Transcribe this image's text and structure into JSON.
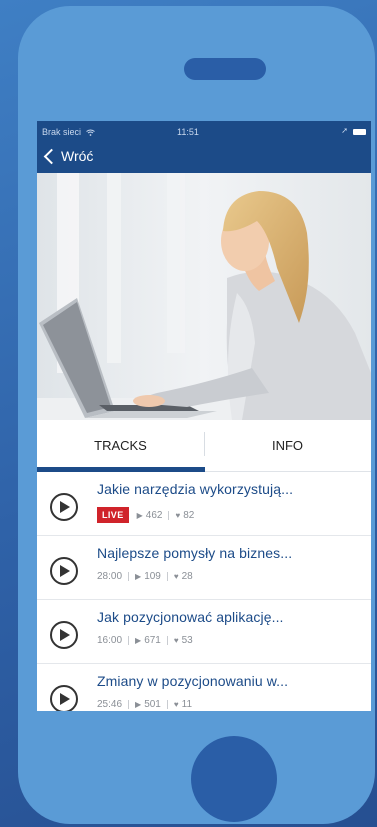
{
  "status_bar": {
    "carrier": "Brak sieci",
    "wifi_icon": "wifi-icon",
    "time": "11:51",
    "location_icon": "location-arrow-icon",
    "battery_icon": "battery-icon"
  },
  "nav": {
    "back_label": "Wróć",
    "back_icon": "chevron-left-icon"
  },
  "hero": {
    "image": "photo of woman typing on a laptop"
  },
  "tabs": [
    {
      "label": "TRACKS",
      "active": true
    },
    {
      "label": "INFO",
      "active": false
    }
  ],
  "tracks": [
    {
      "title": "Jakie narzędzia wykorzystują...",
      "live": "LIVE",
      "duration": "",
      "plays": "462",
      "likes": "82"
    },
    {
      "title": "Najlepsze pomysły na biznes...",
      "live": "",
      "duration": "28:00",
      "plays": "109",
      "likes": "28"
    },
    {
      "title": "Jak pozycjonować aplikację...",
      "live": "",
      "duration": "16:00",
      "plays": "671",
      "likes": "53"
    },
    {
      "title": "Zmiany w pozycjonowaniu w...",
      "live": "",
      "duration": "25:46",
      "plays": "501",
      "likes": "11"
    }
  ],
  "colors": {
    "background": "#2f62a8",
    "phone_body": "#5a9bd6",
    "navbar": "#1c4b88",
    "title_text": "#1c4b88",
    "live_badge": "#d0232a"
  }
}
